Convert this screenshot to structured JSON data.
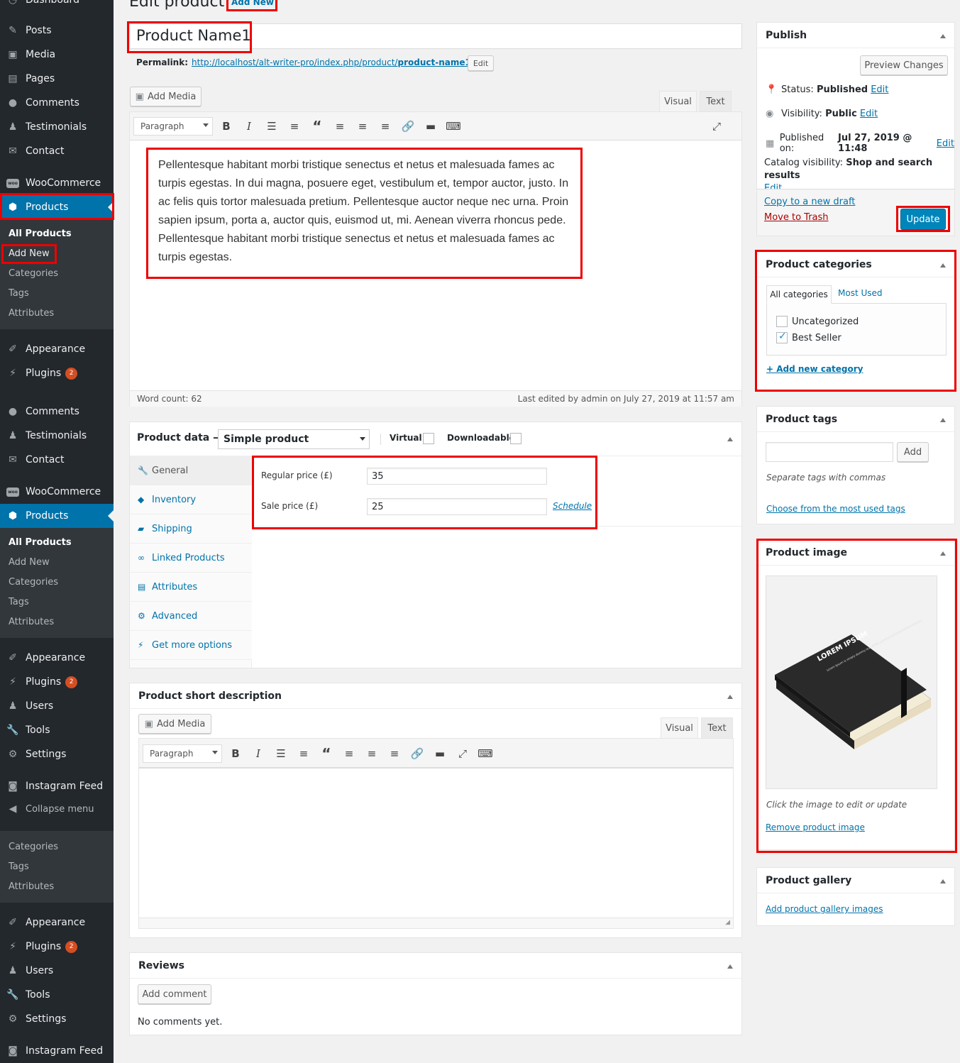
{
  "page": {
    "title": "Edit product",
    "add_new": "Add New"
  },
  "sidebar": {
    "top_partial": "Dashboard",
    "group1": [
      {
        "label": "Posts",
        "icon": "pin-icon"
      },
      {
        "label": "Media",
        "icon": "media-icon"
      },
      {
        "label": "Pages",
        "icon": "pages-icon"
      },
      {
        "label": "Comments",
        "icon": "comments-icon"
      },
      {
        "label": "Testimonials",
        "icon": "user-icon"
      },
      {
        "label": "Contact",
        "icon": "mail-icon"
      }
    ],
    "woocommerce": "WooCommerce",
    "products": "Products",
    "submenu": [
      "All Products",
      "Add New",
      "Categories",
      "Tags",
      "Attributes"
    ],
    "appearance": "Appearance",
    "plugins": "Plugins",
    "plugins_badge": "2",
    "comments": "Comments",
    "testimonials": "Testimonials",
    "contact": "Contact",
    "users": "Users",
    "tools": "Tools",
    "settings": "Settings",
    "instagram": "Instagram Feed",
    "collapse": "Collapse menu"
  },
  "title_input": {
    "value": "Product Name1"
  },
  "permalink": {
    "label": "Permalink:",
    "url_base": "http://localhost/alt-writer-pro/index.php/product/",
    "slug": "product-name1",
    "slash": "/",
    "edit": "Edit"
  },
  "editor": {
    "add_media": "Add Media",
    "tab_visual": "Visual",
    "tab_text": "Text",
    "format": "Paragraph",
    "content": "Pellentesque habitant morbi tristique senectus et netus et malesuada fames ac turpis egestas. In dui magna, posuere eget, vestibulum et, tempor auctor, justo. In ac felis quis tortor malesuada pretium. Pellentesque auctor neque nec urna. Proin sapien ipsum, porta a, auctor quis, euismod ut, mi. Aenean viverra rhoncus pede. Pellentesque habitant morbi tristique senectus et netus et malesuada fames ac turpis egestas.",
    "word_count": "Word count: 62",
    "last_edited": "Last edited by admin on July 27, 2019 at 11:57 am"
  },
  "product_data": {
    "label": "Product data —",
    "type": "Simple product",
    "virtual": "Virtual:",
    "downloadable": "Downloadable:",
    "tabs": [
      {
        "label": "General",
        "icon": "wrench-icon"
      },
      {
        "label": "Inventory",
        "icon": "tag-icon"
      },
      {
        "label": "Shipping",
        "icon": "truck-icon"
      },
      {
        "label": "Linked Products",
        "icon": "link-icon"
      },
      {
        "label": "Attributes",
        "icon": "table-icon"
      },
      {
        "label": "Advanced",
        "icon": "gear-icon"
      },
      {
        "label": "Get more options",
        "icon": "plugin-icon"
      }
    ],
    "regular_price_label": "Regular price (£)",
    "regular_price": "35",
    "sale_price_label": "Sale price (£)",
    "sale_price": "25",
    "schedule": "Schedule"
  },
  "short_desc": {
    "title": "Product short description",
    "add_media": "Add Media",
    "tab_visual": "Visual",
    "tab_text": "Text",
    "format": "Paragraph"
  },
  "reviews": {
    "title": "Reviews",
    "add_comment": "Add comment",
    "none": "No comments yet."
  },
  "publish": {
    "title": "Publish",
    "preview": "Preview Changes",
    "status_label": "Status:",
    "status": "Published",
    "visibility_label": "Visibility:",
    "visibility": "Public",
    "published_label": "Published on:",
    "published": "Jul 27, 2019 @ 11:48",
    "edit": "Edit",
    "catalog_label": "Catalog visibility:",
    "catalog": "Shop and search results",
    "copy": "Copy to a new draft",
    "trash": "Move to Trash",
    "update": "Update"
  },
  "categories": {
    "title": "Product categories",
    "tab_all": "All categories",
    "tab_used": "Most Used",
    "items": [
      {
        "label": "Uncategorized",
        "checked": false
      },
      {
        "label": "Best Seller",
        "checked": true
      }
    ],
    "add_new": "+ Add new category"
  },
  "tags": {
    "title": "Product tags",
    "add": "Add",
    "hint": "Separate tags with commas",
    "choose": "Choose from the most used tags"
  },
  "image": {
    "title": "Product image",
    "book_title": "LOREM IPSUM",
    "book_sub": "Lorem Ipsum is simply dummy text of the printing and typesetting industry",
    "hint": "Click the image to edit or update",
    "remove": "Remove product image"
  },
  "gallery": {
    "title": "Product gallery",
    "add": "Add product gallery images"
  },
  "colors": {
    "accent": "#0073aa",
    "highlight": "#ee0000",
    "sidebar": "#23282d"
  }
}
